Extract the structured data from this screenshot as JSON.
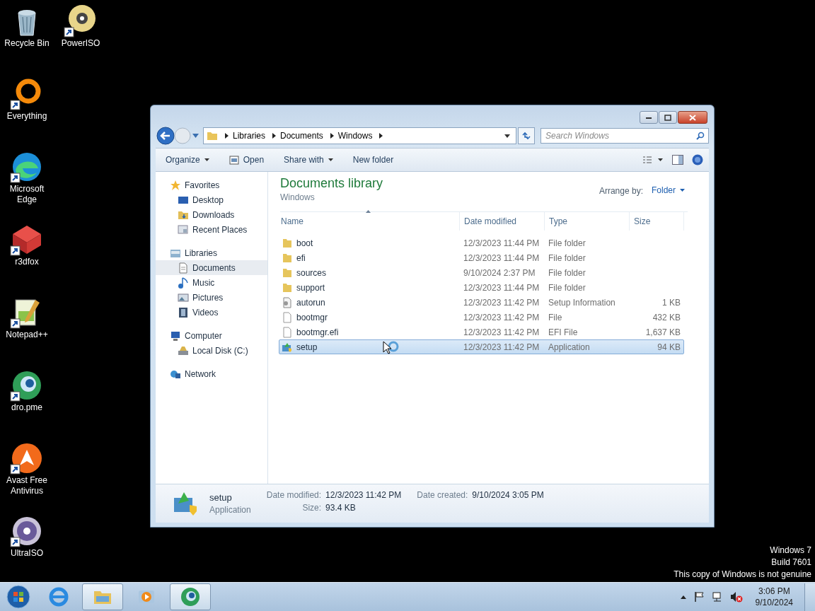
{
  "desktop": {
    "icons": [
      {
        "kind": "recycle-bin",
        "label": "Recycle Bin",
        "shortcut": false
      },
      {
        "kind": "disc-gold",
        "label": "PowerISO",
        "shortcut": true
      },
      {
        "kind": "ring",
        "label": "Everything",
        "shortcut": true
      },
      {
        "kind": "edge",
        "label": "Microsoft Edge",
        "shortcut": true
      },
      {
        "kind": "cube",
        "label": "r3dfox",
        "shortcut": true
      },
      {
        "kind": "notepad",
        "label": "Notepad++",
        "shortcut": true
      },
      {
        "kind": "globe",
        "label": "dro.pme",
        "shortcut": true
      },
      {
        "kind": "avast",
        "label": "Avast Free Antivirus",
        "shortcut": true
      },
      {
        "kind": "disc",
        "label": "UltraISO",
        "shortcut": true
      }
    ],
    "notice": [
      "Windows 7",
      "Build 7601",
      "This copy of Windows is not genuine"
    ]
  },
  "window": {
    "breadcrumb": [
      "Libraries",
      "Documents",
      "Windows"
    ],
    "search": {
      "placeholder": "Search Windows"
    },
    "toolbar": [
      {
        "label": "Organize",
        "kind": "menu"
      },
      {
        "label": "Open",
        "kind": "icon"
      },
      {
        "label": "Share with",
        "kind": "menu"
      },
      {
        "label": "New folder",
        "kind": "plain"
      }
    ],
    "navigation": [
      {
        "label": "Favorites",
        "kind": "star",
        "selected": false,
        "children": [
          {
            "label": "Desktop",
            "kind": "desktop",
            "selected": false
          },
          {
            "label": "Downloads",
            "kind": "downloads",
            "selected": false
          },
          {
            "label": "Recent Places",
            "kind": "recent",
            "selected": false
          }
        ]
      },
      {
        "label": "Libraries",
        "kind": "library",
        "selected": false,
        "children": [
          {
            "label": "Documents",
            "kind": "document",
            "selected": true
          },
          {
            "label": "Music",
            "kind": "music",
            "selected": false
          },
          {
            "label": "Pictures",
            "kind": "pictures",
            "selected": false
          },
          {
            "label": "Videos",
            "kind": "videos",
            "selected": false
          }
        ]
      },
      {
        "label": "Computer",
        "kind": "computer",
        "selected": false,
        "children": [
          {
            "label": "Local Disk (C:)",
            "kind": "disk",
            "selected": false
          }
        ]
      },
      {
        "label": "Network",
        "kind": "network",
        "selected": false
      }
    ],
    "library": {
      "title": "Documents library",
      "subtitle": "Windows",
      "arrange_label": "Arrange by:",
      "arrange_value": "Folder"
    },
    "columns": [
      "Name",
      "Date modified",
      "Type",
      "Size"
    ],
    "rows": [
      {
        "name": "boot",
        "date": "12/3/2023 11:44 PM",
        "type": "File folder",
        "size": "",
        "kind": "folder",
        "selected": false
      },
      {
        "name": "efi",
        "date": "12/3/2023 11:44 PM",
        "type": "File folder",
        "size": "",
        "kind": "folder",
        "selected": false
      },
      {
        "name": "sources",
        "date": "9/10/2024 2:37 PM",
        "type": "File folder",
        "size": "",
        "kind": "folder",
        "selected": false
      },
      {
        "name": "support",
        "date": "12/3/2023 11:44 PM",
        "type": "File folder",
        "size": "",
        "kind": "folder",
        "selected": false
      },
      {
        "name": "autorun",
        "date": "12/3/2023 11:42 PM",
        "type": "Setup Information",
        "size": "1 KB",
        "kind": "settings",
        "selected": false
      },
      {
        "name": "bootmgr",
        "date": "12/3/2023 11:42 PM",
        "type": "File",
        "size": "432 KB",
        "kind": "file",
        "selected": false
      },
      {
        "name": "bootmgr.efi",
        "date": "12/3/2023 11:42 PM",
        "type": "EFI File",
        "size": "1,637 KB",
        "kind": "file",
        "selected": false
      },
      {
        "name": "setup",
        "date": "12/3/2023 11:42 PM",
        "type": "Application",
        "size": "94 KB",
        "kind": "app",
        "selected": true
      }
    ],
    "details": {
      "name": "setup",
      "type": "Application",
      "fields": [
        {
          "label": "Date modified:",
          "value": "12/3/2023 11:42 PM"
        },
        {
          "label": "Date created:",
          "value": "9/10/2024 3:05 PM"
        },
        {
          "label": "Size:",
          "value": "93.4 KB"
        }
      ]
    }
  },
  "taskbar": {
    "apps": [
      {
        "kind": "ie",
        "active": false
      },
      {
        "kind": "explorer",
        "active": true
      },
      {
        "kind": "media",
        "active": false
      },
      {
        "kind": "globe",
        "active": true
      }
    ],
    "clock": {
      "time": "3:06 PM",
      "date": "9/10/2024"
    }
  }
}
